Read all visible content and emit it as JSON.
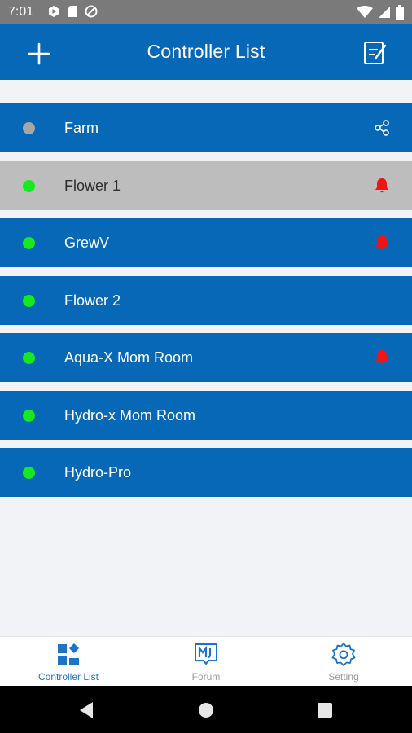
{
  "status_bar": {
    "time": "7:01"
  },
  "app_bar": {
    "title": "Controller List"
  },
  "controllers": [
    {
      "name": "Farm",
      "status_color": "#a6a6a6",
      "icon": "share-icon",
      "icon_color": "#ffffff",
      "selected": false
    },
    {
      "name": "Flower 1",
      "status_color": "#17e81f",
      "icon": "bell-icon",
      "icon_color": "#f01414",
      "selected": true
    },
    {
      "name": "GrewV",
      "status_color": "#17e81f",
      "icon": "bell-icon",
      "icon_color": "#f01414",
      "selected": false
    },
    {
      "name": "Flower 2",
      "status_color": "#17e81f",
      "icon": "",
      "icon_color": "",
      "selected": false
    },
    {
      "name": "Aqua-X Mom Room",
      "status_color": "#17e81f",
      "icon": "bell-icon",
      "icon_color": "#f01414",
      "selected": false
    },
    {
      "name": "Hydro-x Mom Room",
      "status_color": "#17e81f",
      "icon": "",
      "icon_color": "",
      "selected": false
    },
    {
      "name": "Hydro-Pro",
      "status_color": "#17e81f",
      "icon": "",
      "icon_color": "",
      "selected": false
    }
  ],
  "bottom_nav": {
    "items": [
      {
        "label": "Controller List",
        "icon": "dashboard-icon",
        "active": true
      },
      {
        "label": "Forum",
        "icon": "forum-icon",
        "active": false
      },
      {
        "label": "Setting",
        "icon": "settings-gear-icon",
        "active": false
      }
    ]
  },
  "colors": {
    "primary": "#0768b7",
    "selected_row": "#bdbdbd",
    "online": "#17e81f",
    "offline": "#a6a6a6",
    "alert": "#f01414"
  }
}
